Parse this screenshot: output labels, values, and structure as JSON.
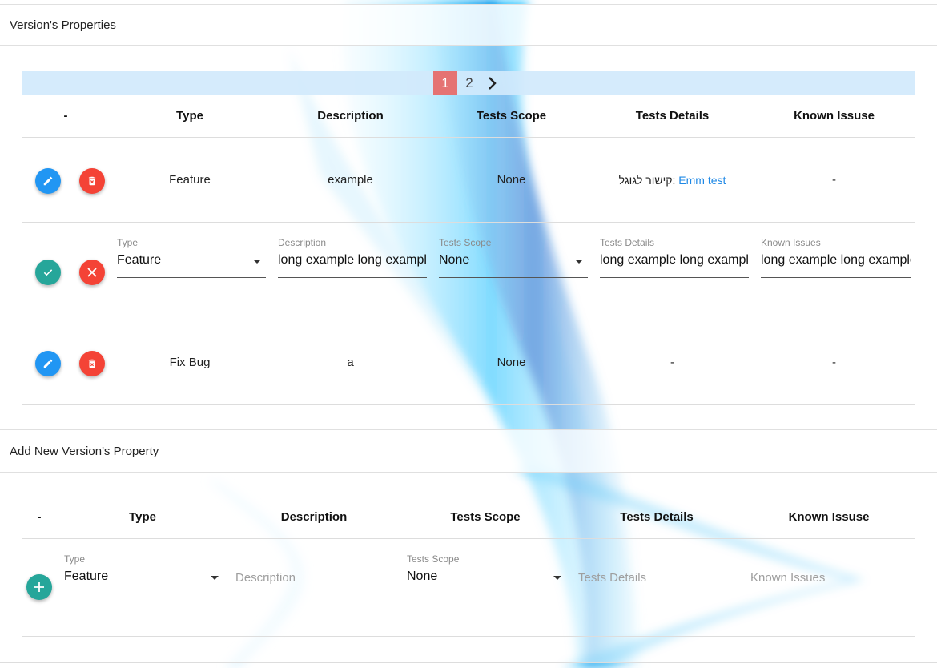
{
  "colors": {
    "primary_blue": "#2196f3",
    "danger_red": "#f44336",
    "accept_teal": "#26a69a",
    "pager_active": "#e57373",
    "link": "#1e88e5"
  },
  "properties_section": {
    "title": "Version's Properties",
    "pagination": {
      "pages": [
        "1",
        "2"
      ],
      "active_page": "1",
      "next_icon": "chevron-right-icon"
    },
    "columns": [
      "-",
      "Type",
      "Description",
      "Tests Scope",
      "Tests Details",
      "Known Issuse"
    ],
    "rows": [
      {
        "mode": "view",
        "type": "Feature",
        "description": "example",
        "tests_scope": "None",
        "tests_details": {
          "prefix": "קישור לגוגל:",
          "link_text": "Emm test"
        },
        "known_issue": "-",
        "actions": [
          "edit-icon",
          "delete-icon"
        ]
      },
      {
        "mode": "edit",
        "fields": {
          "type": {
            "label": "Type",
            "value": "Feature"
          },
          "description": {
            "label": "Description",
            "value": "long example long example"
          },
          "tests_scope": {
            "label": "Tests Scope",
            "value": "None"
          },
          "tests_details": {
            "label": "Tests Details",
            "value": "long example long example"
          },
          "known_issues": {
            "label": "Known Issues",
            "value": "long example long example"
          }
        },
        "actions": [
          "check-icon",
          "cancel-icon"
        ]
      },
      {
        "mode": "view",
        "type": "Fix Bug",
        "description": "a",
        "tests_scope": "None",
        "tests_details": "-",
        "known_issue": "-",
        "actions": [
          "edit-icon",
          "delete-icon"
        ]
      }
    ]
  },
  "add_section": {
    "title": "Add New Version's Property",
    "columns": [
      "-",
      "Type",
      "Description",
      "Tests Scope",
      "Tests Details",
      "Known Issuse"
    ],
    "form": {
      "type": {
        "label": "Type",
        "value": "Feature"
      },
      "description": {
        "placeholder": "Description"
      },
      "tests_scope": {
        "label": "Tests Scope",
        "value": "None"
      },
      "tests_details": {
        "placeholder": "Tests Details"
      },
      "known_issues": {
        "placeholder": "Known Issues"
      },
      "add_icon": "plus-icon"
    }
  }
}
